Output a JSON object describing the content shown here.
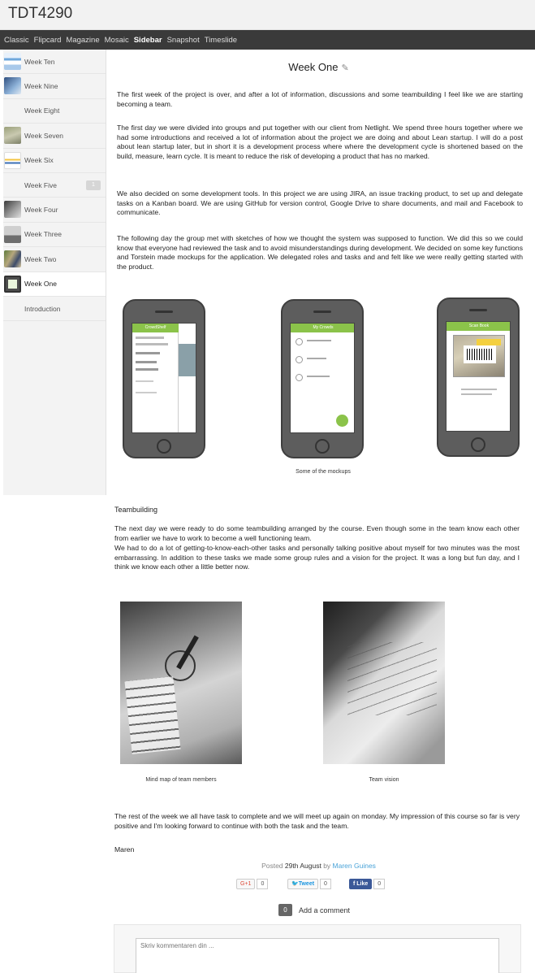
{
  "blog": {
    "title": "TDT4290"
  },
  "nav": [
    {
      "label": "Classic",
      "active": false
    },
    {
      "label": "Flipcard",
      "active": false
    },
    {
      "label": "Magazine",
      "active": false
    },
    {
      "label": "Mosaic",
      "active": false
    },
    {
      "label": "Sidebar",
      "active": true
    },
    {
      "label": "Snapshot",
      "active": false
    },
    {
      "label": "Timeslide",
      "active": false
    }
  ],
  "sidebar": {
    "items": [
      {
        "label": "Week Ten"
      },
      {
        "label": "Week Nine"
      },
      {
        "label": "Week Eight"
      },
      {
        "label": "Week Seven"
      },
      {
        "label": "Week Six"
      },
      {
        "label": "Week Five",
        "badge": "1"
      },
      {
        "label": "Week Four"
      },
      {
        "label": "Week Three"
      },
      {
        "label": "Week Two"
      },
      {
        "label": "Week One",
        "active": true
      },
      {
        "label": "Introduction"
      }
    ]
  },
  "post": {
    "title": "Week One",
    "p1": "The first week of the project is over, and after a lot of information, discussions and some teambuilding I feel like we are starting becoming a team.",
    "p2": "The first day we were divided into groups and put together with our client from Netlight. We spend three hours together where we had some introductions and received a lot of information about the project we are doing and about Lean startup. I will do a post about lean startup later, but in short it is a development process where where the development cycle is shortened based on the build, measure, learn cycle. It is meant to reduce the risk of developing a product that has no marked.",
    "p3": "We also decided on some development tools. In this project we are using JIRA, an issue tracking product, to set up and delegate tasks on a Kanban board. We are using GitHub for version control, Google Drive to share documents, and mail and Facebook to communicate.",
    "p4": "The following day the group met with sketches of how we thought the system was supposed to function. We did this so we could know that everyone had reviewed the task and to avoid misunderstandings during development. We decided on some key functions and Torstein made mockups for the application. We delegated roles and tasks and and felt like we were really getting started with the product.",
    "mockup_caption": "Some of the mockups",
    "mockups": {
      "m1_bar": "CrowdShelf",
      "m2_bar": "My Crowds",
      "m3_bar": "Scan Book"
    },
    "teambuilding_heading": "Teambuilding",
    "p5": "The next day we were ready to do some teambuilding arranged by the course. Even though some in the team know each other from earlier we have to work to become a well functioning team.",
    "p6": "We had to do a lot of getting-to-know-each-other tasks and personally talking positive about myself for two minutes was the most embarrassing. In addition to these tasks we made some group rules and a vision for the project. It was a long but fun day, and I think we know each other a little better now.",
    "photo1_caption": "Mind map of team members",
    "photo2_caption": "Team vision",
    "p7": "The rest of the week we all have task to complete and we will meet up again on monday. My impression of this course so far is very positive and I'm looking forward to continue with both the task and the team.",
    "signature": "Maren"
  },
  "meta": {
    "posted_prefix": "Posted",
    "date": "29th August",
    "by": "by",
    "author": "Maren Guines"
  },
  "share": {
    "gplus_label": "G+1",
    "gplus_count": "0",
    "tweet_label": "Tweet",
    "tweet_count": "0",
    "like_label": "Like",
    "like_count": "0"
  },
  "comments": {
    "count": "0",
    "add_label": "Add a comment",
    "placeholder": "Skriv kommentaren din ..."
  },
  "colors": {
    "nav_bg": "#3a3a3a",
    "accent_link": "#4aa3d8",
    "app_green": "#8bc34a",
    "fb_blue": "#3b5998"
  }
}
